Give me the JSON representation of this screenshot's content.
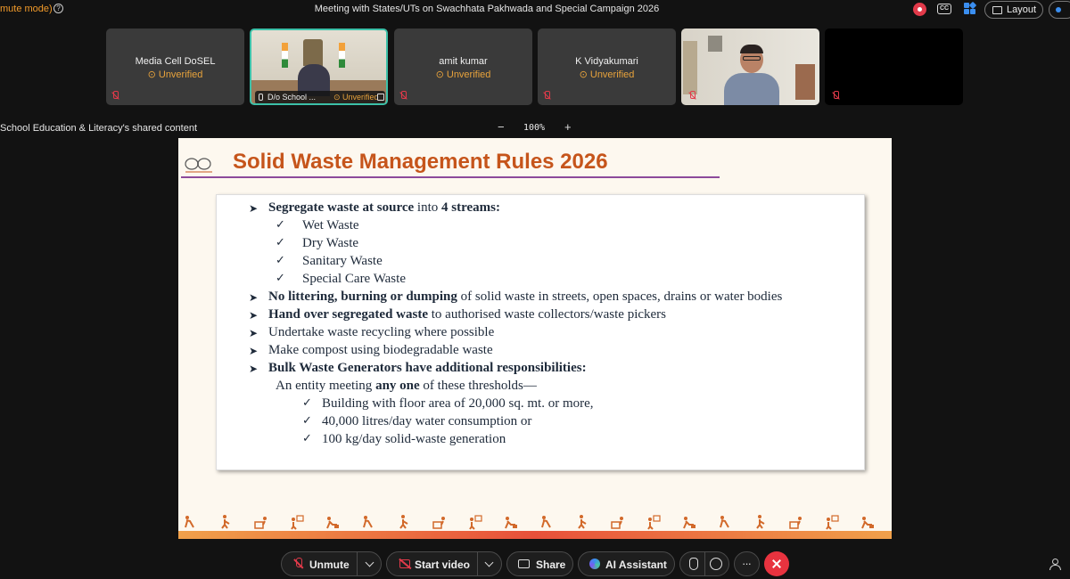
{
  "topbar": {
    "mode_text": "mute mode)",
    "help_icon": "help-circle-icon",
    "meeting_title": "Meeting with States/UTs on Swachhata Pakhwada and Special Campaign 2026",
    "layout_label": "Layout"
  },
  "participants": [
    {
      "name": "Media Cell DoSEL",
      "status": "Unverified"
    },
    {
      "name": "D/o School ...",
      "status": "Unverified",
      "has_video": true
    },
    {
      "name": "amit kumar",
      "status": "Unverified"
    },
    {
      "name": "K Vidyakumari",
      "status": "Unverified"
    },
    {
      "name": "",
      "has_video": true
    },
    {
      "name": ""
    }
  ],
  "content_header": {
    "shared_label": "School Education & Literacy's shared content",
    "zoom_minus": "−",
    "zoom_level": "100%",
    "zoom_plus": "+"
  },
  "slide": {
    "title": "Solid Waste Management Rules 2026",
    "bullets": {
      "segregate_bold": "Segregate waste at source",
      "segregate_rest": " into ",
      "segregate_bold2": "4 streams:",
      "streams": [
        "Wet Waste",
        "Dry Waste",
        "Sanitary Waste",
        "Special Care Waste"
      ],
      "littering_bold": "No littering, burning or dumping",
      "littering_rest": " of solid waste in streets, open spaces, drains or water bodies",
      "handover_bold": "Hand over segregated waste",
      "handover_rest": " to authorised waste collectors/waste pickers",
      "recycling": "Undertake waste recycling where possible",
      "compost": "Make compost using biodegradable waste",
      "bulk_bold": "Bulk Waste Generators have additional responsibilities:",
      "entity_pre": "An entity meeting ",
      "entity_bold": "any one",
      "entity_post": " of these thresholds—",
      "thresholds": [
        "Building with floor area of 20,000 sq. mt. or more,",
        "40,000 litres/day water consumption or",
        "100 kg/day solid-waste generation"
      ]
    },
    "colors": {
      "title": "#c6551b",
      "rule": "#8c4a9b",
      "footer": "#e8503a"
    }
  },
  "controls": {
    "unmute_label": "Unmute",
    "start_video_label": "Start video",
    "share_label": "Share",
    "ai_label": "AI Assistant",
    "end_color": "#e8333f"
  }
}
